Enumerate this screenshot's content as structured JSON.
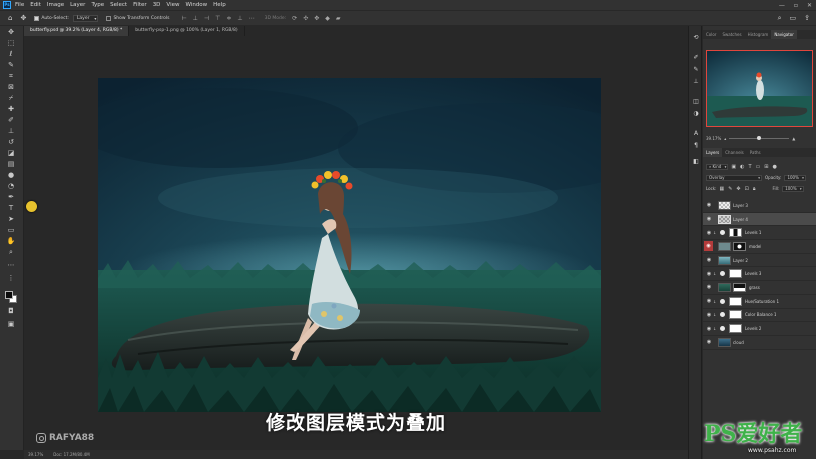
{
  "menubar": {
    "app_icon": "Ps",
    "items": [
      "File",
      "Edit",
      "Image",
      "Layer",
      "Type",
      "Select",
      "Filter",
      "3D",
      "View",
      "Window",
      "Help"
    ]
  },
  "options_bar": {
    "auto_select_label": "Auto-Select:",
    "auto_select_target": "Layer",
    "show_transform_label": "Show Transform Controls",
    "mode_3d_label": "3D Mode:"
  },
  "tabs": [
    {
      "label": "butterfly.psd @ 39.2% (Layer 4, RGB/8) *",
      "active": true
    },
    {
      "label": "butterfly-psp-1.png @ 100% (Layer 1, RGB/8)",
      "active": false
    }
  ],
  "canvas": {
    "subtitle": "修改图层模式为叠加",
    "watermark": "RAFYA88"
  },
  "statusbar": {
    "zoom": "39.17%",
    "doc": "Doc: 17.2M/80.4M"
  },
  "top_panel_tabs": [
    "Color",
    "Swatches",
    "Histogram",
    "Navigator"
  ],
  "top_panel_active": "Navigator",
  "navigator": {
    "zoom": "39.17%"
  },
  "layers_panel": {
    "tabs": [
      "Layers",
      "Channels",
      "Paths"
    ],
    "active_tab": "Layers",
    "filter_kind": "Kind",
    "blend_mode": "Overlay",
    "opacity_label": "Opacity:",
    "opacity_value": "100%",
    "lock_label": "Lock:",
    "fill_label": "Fill:",
    "fill_value": "100%",
    "layers": [
      {
        "name": "Layer 3",
        "type": "pixel",
        "visible": true,
        "selected": false
      },
      {
        "name": "Layer 4",
        "type": "pixel",
        "visible": true,
        "selected": true
      },
      {
        "name": "Levels 1",
        "type": "adjustment",
        "visible": true,
        "selected": false
      },
      {
        "name": "model",
        "type": "pixel",
        "visible": true,
        "selected": false,
        "eye_highlight": true
      },
      {
        "name": "Layer 2",
        "type": "pixel",
        "visible": true,
        "selected": false
      },
      {
        "name": "Levels 3",
        "type": "adjustment",
        "visible": true,
        "selected": false
      },
      {
        "name": "grass",
        "type": "pixel",
        "visible": true,
        "selected": false
      },
      {
        "name": "Hue/Saturation 1",
        "type": "adjustment",
        "visible": true,
        "selected": false
      },
      {
        "name": "Color Balance 1",
        "type": "adjustment",
        "visible": true,
        "selected": false
      },
      {
        "name": "Levels 2",
        "type": "adjustment",
        "visible": true,
        "selected": false
      },
      {
        "name": "cloud",
        "type": "pixel",
        "visible": true,
        "selected": false
      }
    ]
  },
  "site_watermark": {
    "brand": "PS爱好者",
    "url": "www.psahz.com"
  }
}
